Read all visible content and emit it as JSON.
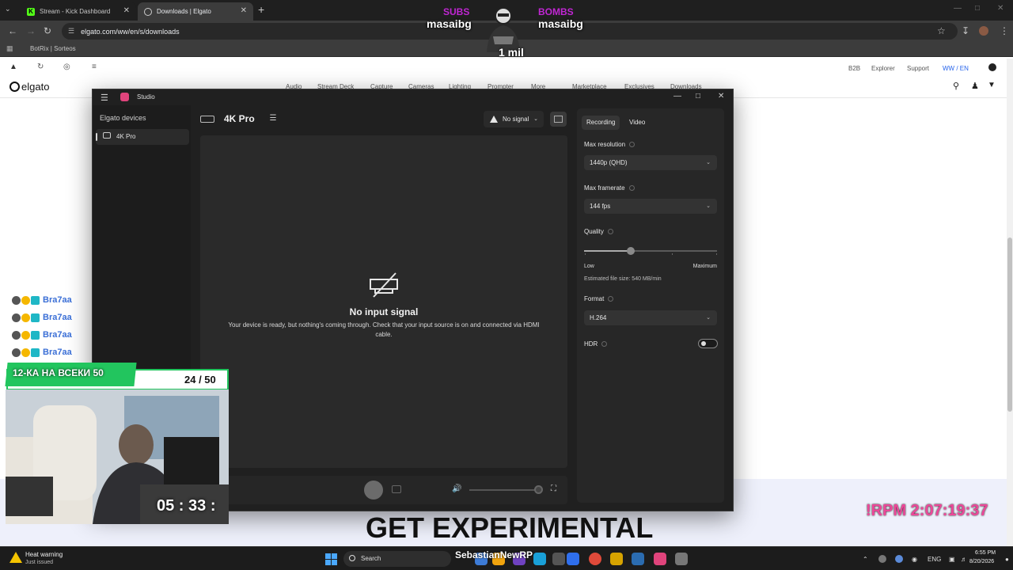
{
  "browser": {
    "tabs": [
      {
        "label": "Stream - Kick Dashboard",
        "active": false
      },
      {
        "label": "Downloads | Elgato",
        "active": true
      }
    ],
    "url": "elgato.com/ww/en/s/downloads",
    "bookmarks": [
      {
        "label": "BotRix | Sorteos"
      }
    ]
  },
  "site": {
    "utility_links": [
      "B2B",
      "Explorer",
      "Support",
      "WW / EN"
    ],
    "logo": "elgato",
    "nav": [
      "Audio",
      "Stream Deck",
      "Capture",
      "Cameras",
      "Lighting",
      "Prompter",
      "More",
      "Marketplace",
      "Exclusives",
      "Downloads"
    ]
  },
  "studio": {
    "title": "Studio",
    "sidebar_heading": "Elgato devices",
    "device_item": "4K Pro",
    "device_title": "4K Pro",
    "signal_status": "No signal",
    "tabs": [
      "Recording",
      "Video"
    ],
    "max_resolution": {
      "label": "Max resolution",
      "value": "1440p (QHD)"
    },
    "max_framerate": {
      "label": "Max framerate",
      "value": "144 fps"
    },
    "quality": {
      "label": "Quality",
      "low": "Low",
      "high": "Maximum",
      "level": 0.35,
      "estimate": "Estimated file size: 540 MB/min"
    },
    "format": {
      "label": "Format",
      "value": "H.264"
    },
    "hdr": {
      "label": "HDR",
      "enabled": false
    },
    "no_signal_title": "No input signal",
    "no_signal_text": "Your device is ready, but nothing's coming through. Check that your input source is on and connected via HDMI cable."
  },
  "overlay": {
    "subs_label": "SUBS",
    "subs_name": "masaibg",
    "bombs_label": "BOMBS",
    "bombs_name": "masaibg",
    "mascot_text": "1 mil",
    "chat": [
      "Bra7aa",
      "Bra7aa",
      "Bra7aa",
      "Bra7aa"
    ],
    "goal_label": "12-КА НА ВСЕКИ 50",
    "goal_count": "24 / 50",
    "goal_progress": 0.48,
    "webcam_timer": "05 : 33 :",
    "banner": "GET EXPERIMENTAL",
    "rpm": "!RPM 2:07:19:37"
  },
  "taskbar": {
    "notification_title": "Heat warning",
    "notification_sub": "Just issued",
    "search_placeholder": "Search",
    "ticker": "SebastianNewRP",
    "language": "ENG",
    "time": "6:55 PM",
    "date": "8/20/2026"
  },
  "colors": {
    "accent_pink": "#e0447c",
    "goal_green": "#22c55e",
    "overlay_purple": "#c026d3"
  }
}
